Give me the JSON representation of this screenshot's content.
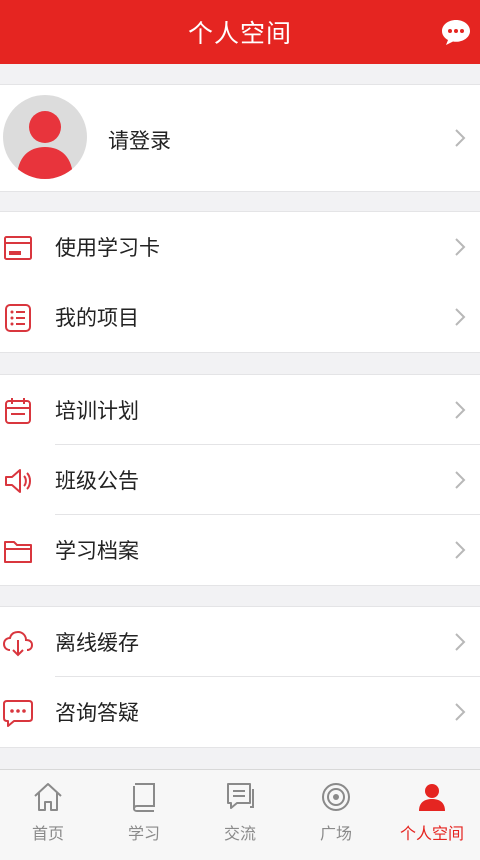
{
  "header": {
    "title": "个人空间",
    "message_icon": "chat-bubble-icon"
  },
  "profile": {
    "login_text": "请登录",
    "avatar_icon": "user-avatar-icon"
  },
  "groups": [
    {
      "items": [
        {
          "label": "使用学习卡",
          "icon": "card-icon"
        },
        {
          "label": "我的项目",
          "icon": "list-icon"
        }
      ]
    },
    {
      "items": [
        {
          "label": "培训计划",
          "icon": "calendar-icon"
        },
        {
          "label": "班级公告",
          "icon": "speaker-icon"
        },
        {
          "label": "学习档案",
          "icon": "folder-icon"
        }
      ]
    },
    {
      "items": [
        {
          "label": "离线缓存",
          "icon": "cloud-download-icon"
        },
        {
          "label": "咨询答疑",
          "icon": "chat-dots-icon"
        }
      ]
    }
  ],
  "tabbar": {
    "items": [
      {
        "label": "首页",
        "icon": "home-icon"
      },
      {
        "label": "学习",
        "icon": "book-icon"
      },
      {
        "label": "交流",
        "icon": "comments-icon"
      },
      {
        "label": "广场",
        "icon": "target-icon"
      },
      {
        "label": "个人空间",
        "icon": "user-icon"
      }
    ],
    "active": "个人空间"
  },
  "colors": {
    "accent": "#e52521",
    "icon_red": "#d9363e",
    "background": "#f2f2f4",
    "inactive": "#8a8a8a"
  }
}
